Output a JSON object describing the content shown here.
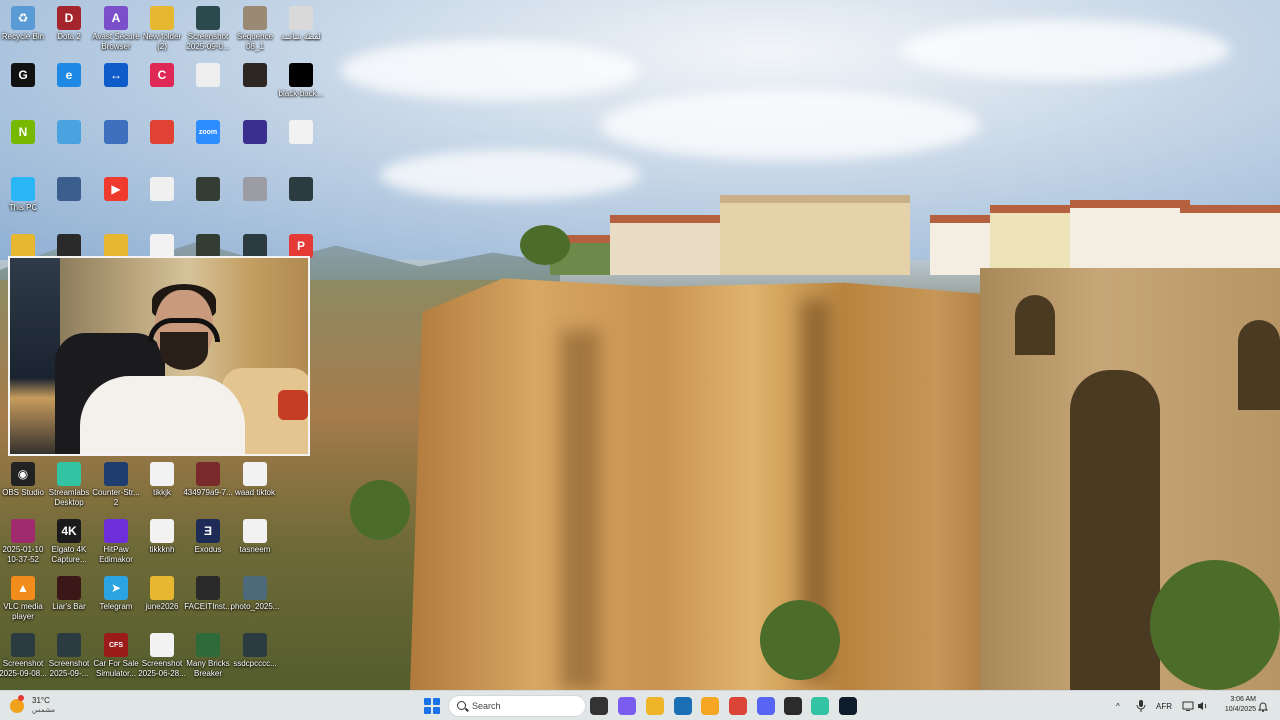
{
  "desktop": {
    "icons": [
      {
        "label": "Recycle Bin",
        "icon": "recycle-bin-icon",
        "color": "#5b9bd5",
        "glyph": "♻"
      },
      {
        "label": "Dota 2",
        "icon": "dota-icon",
        "color": "#a4262c",
        "glyph": "D"
      },
      {
        "label": "Avast Secure\nBrowser",
        "icon": "avast-browser-icon",
        "color": "#7b4fc9",
        "glyph": "A"
      },
      {
        "label": "New folder\n(2)",
        "icon": "folder-icon",
        "color": "#e8b730",
        "glyph": ""
      },
      {
        "label": "Screenshot\n2025-09-0...",
        "icon": "image-file-icon",
        "color": "#2b4a4d",
        "glyph": ""
      },
      {
        "label": "Sequence\n08_1",
        "icon": "video-file-icon",
        "color": "#9a8a74",
        "glyph": ""
      },
      {
        "label": "لقطة شاشة",
        "icon": "image-file-icon",
        "color": "#d9d9d9",
        "glyph": ""
      },
      {
        "label": "",
        "icon": "github-icon",
        "color": "#111111",
        "glyph": "G"
      },
      {
        "label": "",
        "icon": "edge-icon",
        "color": "#1e88e5",
        "glyph": "e"
      },
      {
        "label": "",
        "icon": "teamviewer-icon",
        "color": "#0e5cc9",
        "glyph": "↔"
      },
      {
        "label": "",
        "icon": "capcut-icon",
        "color": "#e02857",
        "glyph": "C"
      },
      {
        "label": "",
        "icon": "text-file-icon",
        "color": "#eeeeee",
        "glyph": ""
      },
      {
        "label": "",
        "icon": "image-file-icon",
        "color": "#2d2622",
        "glyph": ""
      },
      {
        "label": "black-back...",
        "icon": "image-file-icon",
        "color": "#000000",
        "glyph": ""
      },
      {
        "label": "",
        "icon": "nvidia-icon",
        "color": "#76b900",
        "glyph": "N"
      },
      {
        "label": "",
        "icon": "network-icon",
        "color": "#4aa3df",
        "glyph": ""
      },
      {
        "label": "",
        "icon": "app-icon",
        "color": "#3c6fbe",
        "glyph": ""
      },
      {
        "label": "",
        "icon": "chrome-icon",
        "color": "#e14133",
        "glyph": ""
      },
      {
        "label": "",
        "icon": "zoom-icon",
        "color": "#2d8cff",
        "glyph": "zoom"
      },
      {
        "label": "",
        "icon": "obs-alt-icon",
        "color": "#3a2f8e",
        "glyph": ""
      },
      {
        "label": "",
        "icon": "image-file-icon",
        "color": "#f2f2f2",
        "glyph": ""
      },
      {
        "label": "This PC",
        "icon": "pc-icon",
        "color": "#29b6f6",
        "glyph": ""
      },
      {
        "label": "",
        "icon": "game-icon",
        "color": "#3b5e8c",
        "glyph": ""
      },
      {
        "label": "",
        "icon": "anydesk-icon",
        "color": "#ef3b2d",
        "glyph": "▶"
      },
      {
        "label": "",
        "icon": "image-file-icon",
        "color": "#f0f0f0",
        "glyph": ""
      },
      {
        "label": "",
        "icon": "phone-file-icon",
        "color": "#333d33",
        "glyph": ""
      },
      {
        "label": "",
        "icon": "image-file-icon",
        "color": "#9c9ca4",
        "glyph": ""
      },
      {
        "label": "",
        "icon": "image-file-icon",
        "color": "#2b3b3f",
        "glyph": ""
      },
      {
        "label": "",
        "icon": "folder-icon",
        "color": "#e8b730",
        "glyph": ""
      },
      {
        "label": "",
        "icon": "faceit-icon",
        "color": "#2a2a2a",
        "glyph": ""
      },
      {
        "label": "",
        "icon": "folder-icon",
        "color": "#e8b730",
        "glyph": ""
      },
      {
        "label": "",
        "icon": "image-file-icon",
        "color": "#f2f2f2",
        "glyph": ""
      },
      {
        "label": "",
        "icon": "phone-file-icon",
        "color": "#333d33",
        "glyph": ""
      },
      {
        "label": "",
        "icon": "image-file-icon",
        "color": "#2b3b3f",
        "glyph": ""
      },
      {
        "label": "",
        "icon": "pdf-icon",
        "color": "#e53935",
        "glyph": "P"
      },
      {
        "label": "OBS Studio",
        "icon": "obs-icon",
        "color": "#222222",
        "glyph": "◉"
      },
      {
        "label": "Streamlabs\nDesktop",
        "icon": "streamlabs-icon",
        "color": "#31c3a2",
        "glyph": ""
      },
      {
        "label": "Counter-Str...\n2",
        "icon": "cs2-icon",
        "color": "#1f3e6f",
        "glyph": ""
      },
      {
        "label": "tikkjk",
        "icon": "image-file-icon",
        "color": "#f2f2f2",
        "glyph": ""
      },
      {
        "label": "434979a9-7...",
        "icon": "phone-file-icon",
        "color": "#7a2a2a",
        "glyph": ""
      },
      {
        "label": "waad tiktok",
        "icon": "phone-file-icon",
        "color": "#f2f2f2",
        "glyph": ""
      },
      {
        "label": "2025-01-10\n10-37-52",
        "icon": "winrar-icon",
        "color": "#a02a6e",
        "glyph": ""
      },
      {
        "label": "Elgato 4K\nCapture...",
        "icon": "elgato-icon",
        "color": "#1b1b1b",
        "glyph": "4K"
      },
      {
        "label": "HitPaw\nEdimakor",
        "icon": "hitpaw-icon",
        "color": "#6d2fd9",
        "glyph": ""
      },
      {
        "label": "tikkknh",
        "icon": "image-file-icon",
        "color": "#f2f2f2",
        "glyph": ""
      },
      {
        "label": "Exodus",
        "icon": "exodus-icon",
        "color": "#1f2b57",
        "glyph": "Ǝ"
      },
      {
        "label": "tasneem",
        "icon": "phone-file-icon",
        "color": "#f2f2f2",
        "glyph": ""
      },
      {
        "label": "VLC media\nplayer",
        "icon": "vlc-icon",
        "color": "#f28c1b",
        "glyph": "▲"
      },
      {
        "label": "Liar's Bar",
        "icon": "game-icon",
        "color": "#3a1818",
        "glyph": ""
      },
      {
        "label": "Telegram",
        "icon": "telegram-icon",
        "color": "#2aa3e0",
        "glyph": "➤"
      },
      {
        "label": "june2026",
        "icon": "folder-icon",
        "color": "#e8b730",
        "glyph": ""
      },
      {
        "label": "FACEITInst...",
        "icon": "faceit-icon",
        "color": "#2a2a2a",
        "glyph": ""
      },
      {
        "label": "photo_2025...",
        "icon": "image-file-icon",
        "color": "#4d6a7b",
        "glyph": ""
      },
      {
        "label": "Screenshot\n2025-09-08...",
        "icon": "image-file-icon",
        "color": "#2b3b3f",
        "glyph": ""
      },
      {
        "label": "Screenshot\n2025-09-...",
        "icon": "image-file-icon",
        "color": "#2b3b3f",
        "glyph": ""
      },
      {
        "label": "Car For Sale\nSimulator...",
        "icon": "cfs-game-icon",
        "color": "#9b1b1b",
        "glyph": "CFS"
      },
      {
        "label": "Screenshot\n2025-06-28...",
        "icon": "image-file-icon",
        "color": "#f2f2f2",
        "glyph": ""
      },
      {
        "label": "Many Bricks\nBreaker",
        "icon": "bricks-game-icon",
        "color": "#2f6b3a",
        "glyph": ""
      },
      {
        "label": "ssdcpcccc...",
        "icon": "image-file-icon",
        "color": "#2b3b3f",
        "glyph": ""
      }
    ]
  },
  "taskbar": {
    "weather": {
      "temp": "31°C",
      "location": "مشمس",
      "icon": "sun-icon"
    },
    "search_placeholder": "Search",
    "apps": [
      {
        "icon": "task-view-icon",
        "color": "#333333"
      },
      {
        "icon": "copilot-icon",
        "color": "#7b5cf0"
      },
      {
        "icon": "file-explorer-icon",
        "color": "#f0b429"
      },
      {
        "icon": "store-icon",
        "color": "#1a6fb5"
      },
      {
        "icon": "browser-icon",
        "color": "#f5a623"
      },
      {
        "icon": "chrome-icon",
        "color": "#db4437"
      },
      {
        "icon": "discord-icon",
        "color": "#5865f2"
      },
      {
        "icon": "app-icon",
        "color": "#2b2b2b"
      },
      {
        "icon": "streamlabs-icon",
        "color": "#31c3a2"
      },
      {
        "icon": "teamviewer-icon",
        "color": "#0e1b2b"
      }
    ],
    "tray": {
      "chevron": "^",
      "mic": "mic-icon",
      "lang": "AFR",
      "network": "network-icon",
      "volume": "volume-icon"
    },
    "clock": {
      "time": "3:06 AM",
      "date": "10/4/2025"
    }
  }
}
